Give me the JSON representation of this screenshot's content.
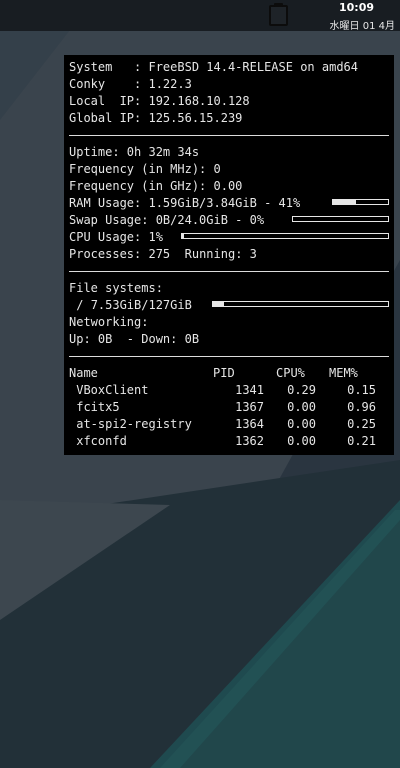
{
  "panel": {
    "time": "10:09",
    "date": "水曜日 01 4月"
  },
  "conky": {
    "system": {
      "label": "System   : ",
      "value": "FreeBSD 14.4-RELEASE on amd64"
    },
    "conky": {
      "label": "Conky    : ",
      "value": "1.22.3"
    },
    "local_ip": {
      "label": "Local  IP: ",
      "value": "192.168.10.128"
    },
    "global_ip": {
      "label": "Global IP: ",
      "value": "125.56.15.239"
    },
    "uptime": {
      "label": "Uptime: ",
      "value": "0h 32m 34s"
    },
    "freq_mhz": {
      "label": "Frequency (in MHz): ",
      "value": "0"
    },
    "freq_ghz": {
      "label": "Frequency (in GHz): ",
      "value": "0.00"
    },
    "ram": {
      "label": "RAM Usage: ",
      "value": "1.59GiB/3.84GiB - 41%",
      "percent": 41
    },
    "swap": {
      "label": "Swap Usage: ",
      "value": "0B/24.0GiB - 0%",
      "percent": 0
    },
    "cpu": {
      "label": "CPU Usage: ",
      "value": "1%",
      "percent": 1
    },
    "processes": {
      "label": "Processes: ",
      "value": "275",
      "running_label": "  Running: ",
      "running_value": "3"
    },
    "filesystems": {
      "title": "File systems:",
      "mount": " / ",
      "value": "7.53GiB/127GiB",
      "percent": 6
    },
    "networking": {
      "title": "Networking:",
      "up_label": "Up: ",
      "up_value": "0B",
      "down_label": "  - Down: ",
      "down_value": "0B"
    },
    "proc_table": {
      "headers": [
        "Name",
        "PID",
        "CPU%",
        "MEM%"
      ],
      "rows": [
        [
          " VBoxClient",
          "1341",
          "0.29",
          "0.15"
        ],
        [
          " fcitx5",
          "1367",
          "0.00",
          "0.96"
        ],
        [
          " at-spi2-registry",
          "1364",
          "0.00",
          "0.25"
        ],
        [
          " xfconfd",
          "1362",
          "0.00",
          "0.21"
        ]
      ]
    }
  }
}
